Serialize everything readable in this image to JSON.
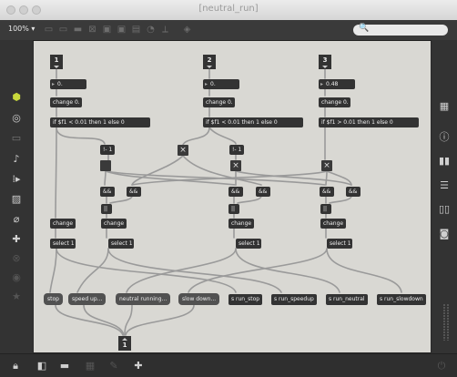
{
  "window": {
    "title": "[neutral_run]"
  },
  "toolbar": {
    "zoom": "100% ▾",
    "search_icon": "🔍"
  },
  "left_sidebar": {
    "icons": [
      "cube-icon",
      "target-icon",
      "keyboard-icon",
      "music-note-icon",
      "step-icon",
      "image-icon",
      "paperclip-icon",
      "puzzle-icon",
      "x-circle-icon",
      "info-circle-icon",
      "star-icon"
    ]
  },
  "right_sidebar": {
    "icons": [
      "grid-icon",
      "info-icon",
      "book-icon",
      "list-icon",
      "columns-icon",
      "camera-icon"
    ]
  },
  "bottom_bar": {
    "icons": [
      "lock-icon",
      "layers-icon",
      "presentation-icon",
      "grid-toggle-icon",
      "paint-icon",
      "wrench-icon"
    ]
  },
  "patch": {
    "inlets": [
      "1",
      "2",
      "3"
    ],
    "floats": [
      "0.",
      "0.",
      "0.48"
    ],
    "change_msgs": [
      "change 0.",
      "change 0.",
      "change 0."
    ],
    "ifs": [
      "if $f1 < 0.01 then 1 else 0",
      "if $f1 < 0.01 then 1 else 0",
      "if $f1 > 0.01 then 1 else 0"
    ],
    "minus": [
      "!- 1",
      "!- 1"
    ],
    "ands": [
      "&&",
      "&&",
      "&&",
      "&&",
      "&&",
      "&&"
    ],
    "ors": [
      "||",
      "||",
      "||"
    ],
    "changes": [
      "change",
      "change",
      "change",
      "change"
    ],
    "selects": [
      "select 1",
      "select 1",
      "select 1",
      "select 1"
    ],
    "messages": [
      "stop",
      "speed up...",
      "neutral running...",
      "slow down...",
      "s run_stop",
      "s run_speedup",
      "s run_neutral",
      "s run_slowdown"
    ],
    "outlet": "1",
    "toggle_mark": "×"
  }
}
